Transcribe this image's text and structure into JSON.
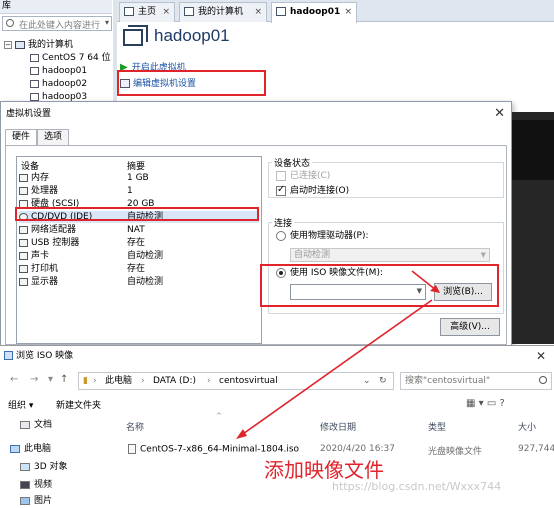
{
  "vmware": {
    "library_title": "库",
    "library_search_placeholder": "在此处键入内容进行",
    "tree": {
      "root": "我的计算机",
      "items": [
        "CentOS 7 64 位",
        "hadoop01",
        "hadoop02",
        "hadoop03"
      ]
    },
    "tabs": [
      {
        "label": "主页"
      },
      {
        "label": "我的计算机"
      },
      {
        "label": "hadoop01"
      }
    ],
    "vm_title": "hadoop01",
    "power_on": "开启此虚拟机",
    "edit_settings": "编辑虚拟机设置"
  },
  "vm_settings": {
    "title": "虚拟机设置",
    "tabs": [
      "硬件",
      "选项"
    ],
    "columns": {
      "device": "设备",
      "summary": "摘要"
    },
    "devices": [
      {
        "device": "内存",
        "summary": "1 GB"
      },
      {
        "device": "处理器",
        "summary": "1"
      },
      {
        "device": "硬盘 (SCSI)",
        "summary": "20 GB"
      },
      {
        "device": "CD/DVD (IDE)",
        "summary": "自动检测"
      },
      {
        "device": "网络适配器",
        "summary": "NAT"
      },
      {
        "device": "USB 控制器",
        "summary": "存在"
      },
      {
        "device": "声卡",
        "summary": "自动检测"
      },
      {
        "device": "打印机",
        "summary": "存在"
      },
      {
        "device": "显示器",
        "summary": "自动检测"
      }
    ],
    "device_status": {
      "label": "设备状态",
      "connected": "已连接(C)",
      "connect_on_power_on": "启动时连接(O)"
    },
    "connection": {
      "label": "连接",
      "use_physical": "使用物理驱动器(P):",
      "physical_value": "自动检测",
      "use_iso": "使用 ISO 映像文件(M):",
      "iso_value": "",
      "browse": "浏览(B)..."
    },
    "advanced": "高级(V)..."
  },
  "iso_dialog": {
    "title": "浏览 ISO 映像",
    "breadcrumb": [
      "此电脑",
      "DATA (D:)",
      "centosvirtual"
    ],
    "search_placeholder": "搜索\"centosvirtual\"",
    "organize": "组织 ▾",
    "new_folder": "新建文件夹",
    "nav": [
      "文档",
      "此电脑",
      "3D 对象",
      "视频",
      "图片"
    ],
    "columns": [
      "名称",
      "修改日期",
      "类型",
      "大小"
    ],
    "files": [
      {
        "name": "CentOS-7-x86_64-Minimal-1804.iso",
        "date": "2020/4/20 16:37",
        "type": "光盘映像文件",
        "size": "927,744"
      }
    ]
  },
  "annotation": "添加映像文件",
  "watermark": "https://blog.csdn.net/Wxxx744",
  "colors": {
    "highlight": "#e0242c",
    "link": "#1a53a6"
  }
}
